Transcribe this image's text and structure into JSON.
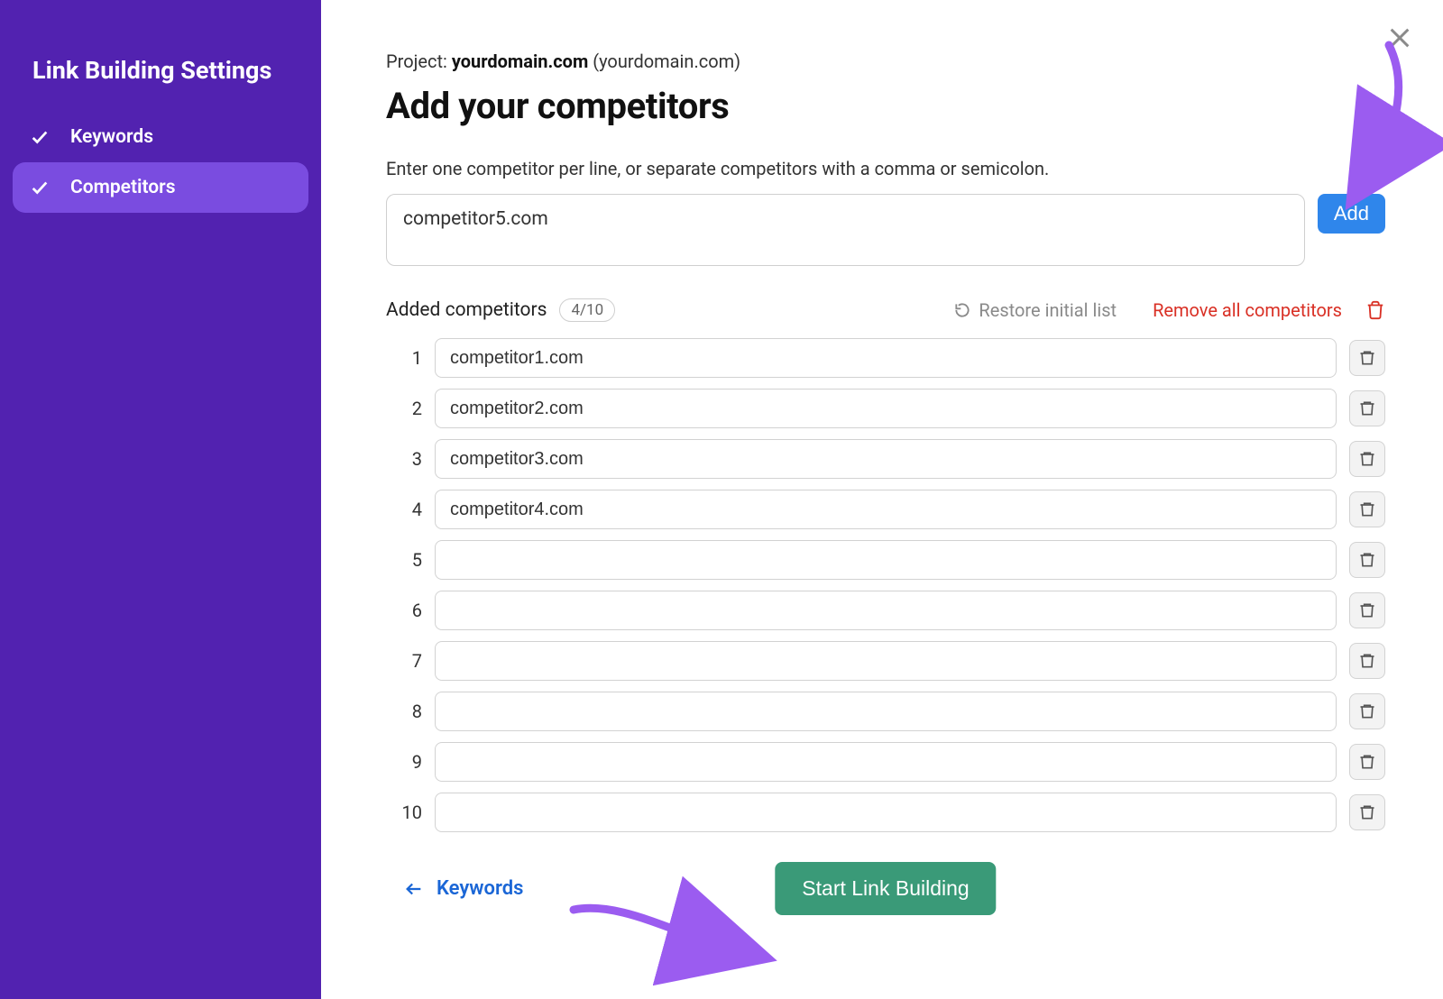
{
  "sidebar": {
    "title": "Link Building Settings",
    "items": [
      {
        "label": "Keywords",
        "completed": true,
        "active": false
      },
      {
        "label": "Competitors",
        "completed": true,
        "active": true
      }
    ]
  },
  "main": {
    "project_label": "Project:",
    "project_domain_bold": "yourdomain.com",
    "project_domain_paren": "(yourdomain.com)",
    "title": "Add your competitors",
    "instruction": "Enter one competitor per line, or separate competitors with a comma or semicolon.",
    "textarea_value": "competitor5.com",
    "add_button": "Add",
    "list_header_label": "Added competitors",
    "count_text": "4/10",
    "restore_label": "Restore initial list",
    "remove_all_label": "Remove all competitors",
    "rows": [
      {
        "num": "1",
        "value": "competitor1.com"
      },
      {
        "num": "2",
        "value": "competitor2.com"
      },
      {
        "num": "3",
        "value": "competitor3.com"
      },
      {
        "num": "4",
        "value": "competitor4.com"
      },
      {
        "num": "5",
        "value": ""
      },
      {
        "num": "6",
        "value": ""
      },
      {
        "num": "7",
        "value": ""
      },
      {
        "num": "8",
        "value": ""
      },
      {
        "num": "9",
        "value": ""
      },
      {
        "num": "10",
        "value": ""
      }
    ],
    "back_label": "Keywords",
    "start_button": "Start Link Building"
  },
  "colors": {
    "sidebar_bg": "#5222b0",
    "sidebar_active": "#7a4ce0",
    "primary_blue": "#2f86eb",
    "danger_red": "#d93025",
    "success_green": "#3a9a78",
    "annotation_purple": "#9b5cf0"
  }
}
